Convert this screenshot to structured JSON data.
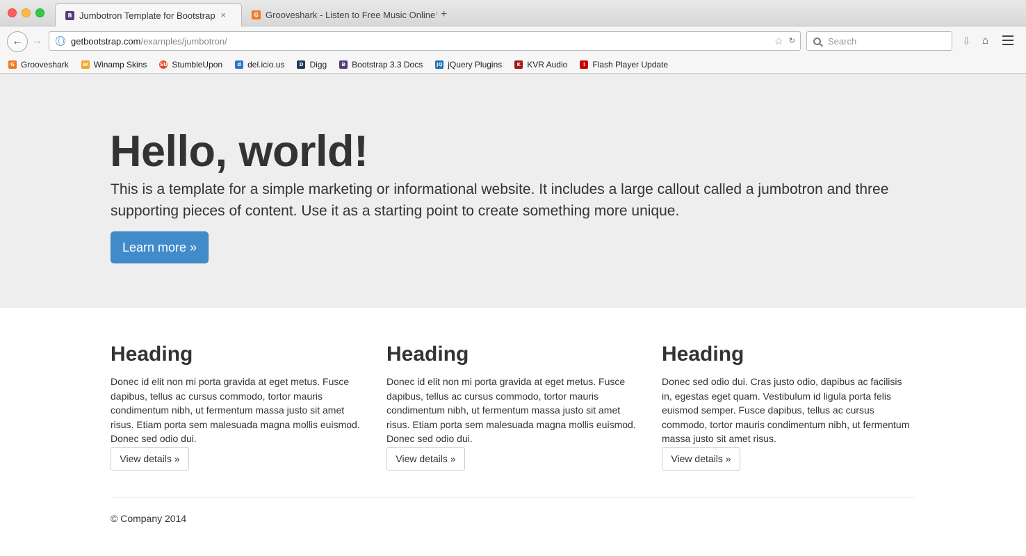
{
  "browser": {
    "tabs": [
      {
        "title": "Jumbotron Template for Bootstrap",
        "favicon_letter": "B",
        "favicon_color": "#563d7c",
        "active": true
      },
      {
        "title": "Grooveshark - Listen to Free Music Online",
        "favicon_letter": "G",
        "favicon_color": "#f37a1f",
        "active": false
      }
    ],
    "tab_close": "×",
    "tab_overflow": "›",
    "new_tab": "+",
    "url_host": "getbootstrap.com",
    "url_path": "/examples/jumbotron/",
    "search_placeholder": "Search",
    "icons": {
      "back": "←",
      "forward": "→",
      "star": "☆",
      "reload": "↻",
      "download": "⇩",
      "home": "⌂"
    },
    "bookmarks": [
      {
        "label": "Grooveshark",
        "letter": "G",
        "color": "#f37a1f"
      },
      {
        "label": "Winamp Skins",
        "letter": "W",
        "color": "#f5a623"
      },
      {
        "label": "StumbleUpon",
        "letter": "SU",
        "color": "#eb4924"
      },
      {
        "label": "del.icio.us",
        "letter": "d",
        "color": "#3274d1"
      },
      {
        "label": "Digg",
        "letter": "D",
        "color": "#1d3b5c"
      },
      {
        "label": "Bootstrap 3.3 Docs",
        "letter": "B",
        "color": "#563d7c"
      },
      {
        "label": "jQuery Plugins",
        "letter": "jQ",
        "color": "#1f6fb2"
      },
      {
        "label": "KVR Audio",
        "letter": "K",
        "color": "#a01818"
      },
      {
        "label": "Flash Player Update",
        "letter": "!",
        "color": "#cc0000"
      }
    ]
  },
  "jumbotron": {
    "title": "Hello, world!",
    "lead": "This is a template for a simple marketing or informational website. It includes a large callout called a jumbotron and three supporting pieces of content. Use it as a starting point to create something more unique.",
    "button": "Learn more »"
  },
  "columns": [
    {
      "heading": "Heading",
      "text": "Donec id elit non mi porta gravida at eget metus. Fusce dapibus, tellus ac cursus commodo, tortor mauris condimentum nibh, ut fermentum massa justo sit amet risus. Etiam porta sem malesuada magna mollis euismod. Donec sed odio dui.",
      "button": "View details »"
    },
    {
      "heading": "Heading",
      "text": "Donec id elit non mi porta gravida at eget metus. Fusce dapibus, tellus ac cursus commodo, tortor mauris condimentum nibh, ut fermentum massa justo sit amet risus. Etiam porta sem malesuada magna mollis euismod. Donec sed odio dui.",
      "button": "View details »"
    },
    {
      "heading": "Heading",
      "text": "Donec sed odio dui. Cras justo odio, dapibus ac facilisis in, egestas eget quam. Vestibulum id ligula porta felis euismod semper. Fusce dapibus, tellus ac cursus commodo, tortor mauris condimentum nibh, ut fermentum massa justo sit amet risus.",
      "button": "View details »"
    }
  ],
  "footer": {
    "text": "© Company 2014"
  },
  "colors": {
    "primary": "#428bca",
    "jumbotron_bg": "#eeeeee"
  }
}
